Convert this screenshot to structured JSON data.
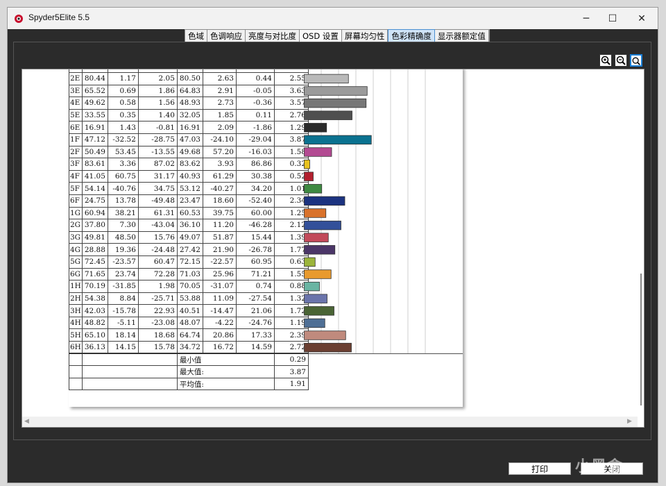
{
  "window": {
    "title": "Spyder5Elite 5.5"
  },
  "window_controls": {
    "minimize": "─",
    "maximize": "☐",
    "close": "✕"
  },
  "tabs": [
    {
      "label": "色域"
    },
    {
      "label": "色调响应"
    },
    {
      "label": "亮度与对比度"
    },
    {
      "label": "OSD 设置"
    },
    {
      "label": "屏幕均匀性"
    },
    {
      "label": "色彩精确度"
    },
    {
      "label": "显示器额定值"
    }
  ],
  "active_tab": "色彩精确度",
  "table": {
    "rows": [
      {
        "id": "2E",
        "l1": "80.44",
        "a1": "1.17",
        "b1": "2.05",
        "l2": "80.50",
        "a2": "2.63",
        "b2": "0.44",
        "de": "2.55",
        "color": "#b9b9b9"
      },
      {
        "id": "3E",
        "l1": "65.52",
        "a1": "0.69",
        "b1": "1.86",
        "l2": "64.83",
        "a2": "2.91",
        "b2": "-0.05",
        "de": "3.63",
        "color": "#9b9b9b"
      },
      {
        "id": "4E",
        "l1": "49.62",
        "a1": "0.58",
        "b1": "1.56",
        "l2": "48.93",
        "a2": "2.73",
        "b2": "-0.36",
        "de": "3.57",
        "color": "#777777"
      },
      {
        "id": "5E",
        "l1": "33.55",
        "a1": "0.35",
        "b1": "1.40",
        "l2": "32.05",
        "a2": "1.85",
        "b2": "0.11",
        "de": "2.76",
        "color": "#4f4f4f"
      },
      {
        "id": "6E",
        "l1": "16.91",
        "a1": "1.43",
        "b1": "-0.81",
        "l2": "16.91",
        "a2": "2.09",
        "b2": "-1.86",
        "de": "1.29",
        "color": "#2a2a2a"
      },
      {
        "id": "1F",
        "l1": "47.12",
        "a1": "-32.52",
        "b1": "-28.75",
        "l2": "47.03",
        "a2": "-24.10",
        "b2": "-29.04",
        "de": "3.87",
        "color": "#0b7290"
      },
      {
        "id": "2F",
        "l1": "50.49",
        "a1": "53.45",
        "b1": "-13.55",
        "l2": "49.68",
        "a2": "57.20",
        "b2": "-16.03",
        "de": "1.58",
        "color": "#b34a92"
      },
      {
        "id": "3F",
        "l1": "83.61",
        "a1": "3.36",
        "b1": "87.02",
        "l2": "83.62",
        "a2": "3.93",
        "b2": "86.86",
        "de": "0.32",
        "color": "#e7c21f"
      },
      {
        "id": "4F",
        "l1": "41.05",
        "a1": "60.75",
        "b1": "31.17",
        "l2": "40.93",
        "a2": "61.29",
        "b2": "30.38",
        "de": "0.52",
        "color": "#b21f2e"
      },
      {
        "id": "5F",
        "l1": "54.14",
        "a1": "-40.76",
        "b1": "34.75",
        "l2": "53.12",
        "a2": "-40.27",
        "b2": "34.20",
        "de": "1.01",
        "color": "#3f8a42"
      },
      {
        "id": "6F",
        "l1": "24.75",
        "a1": "13.78",
        "b1": "-49.48",
        "l2": "23.47",
        "a2": "18.60",
        "b2": "-52.40",
        "de": "2.34",
        "color": "#1c3380"
      },
      {
        "id": "1G",
        "l1": "60.94",
        "a1": "38.21",
        "b1": "61.31",
        "l2": "60.53",
        "a2": "39.75",
        "b2": "60.00",
        "de": "1.25",
        "color": "#d9722b"
      },
      {
        "id": "2G",
        "l1": "37.80",
        "a1": "7.30",
        "b1": "-43.04",
        "l2": "36.10",
        "a2": "11.20",
        "b2": "-46.28",
        "de": "2.12",
        "color": "#33509a"
      },
      {
        "id": "3G",
        "l1": "49.81",
        "a1": "48.50",
        "b1": "15.76",
        "l2": "49.07",
        "a2": "51.87",
        "b2": "15.44",
        "de": "1.39",
        "color": "#c24a5a"
      },
      {
        "id": "4G",
        "l1": "28.88",
        "a1": "19.36",
        "b1": "-24.48",
        "l2": "27.42",
        "a2": "21.90",
        "b2": "-26.78",
        "de": "1.77",
        "color": "#4b3668"
      },
      {
        "id": "5G",
        "l1": "72.45",
        "a1": "-23.57",
        "b1": "60.47",
        "l2": "72.15",
        "a2": "-22.57",
        "b2": "60.95",
        "de": "0.63",
        "color": "#9bb43b"
      },
      {
        "id": "6G",
        "l1": "71.65",
        "a1": "23.74",
        "b1": "72.28",
        "l2": "71.03",
        "a2": "25.96",
        "b2": "71.21",
        "de": "1.55",
        "color": "#e89a2e"
      },
      {
        "id": "1H",
        "l1": "70.19",
        "a1": "-31.85",
        "b1": "1.98",
        "l2": "70.05",
        "a2": "-31.07",
        "b2": "0.74",
        "de": "0.88",
        "color": "#6ab5a3"
      },
      {
        "id": "2H",
        "l1": "54.38",
        "a1": "8.84",
        "b1": "-25.71",
        "l2": "53.88",
        "a2": "11.09",
        "b2": "-27.54",
        "de": "1.32",
        "color": "#6a74ab"
      },
      {
        "id": "3H",
        "l1": "42.03",
        "a1": "-15.78",
        "b1": "22.93",
        "l2": "40.51",
        "a2": "-14.47",
        "b2": "21.06",
        "de": "1.72",
        "color": "#4a6435"
      },
      {
        "id": "4H",
        "l1": "48.82",
        "a1": "-5.11",
        "b1": "-23.08",
        "l2": "48.07",
        "a2": "-4.22",
        "b2": "-24.76",
        "de": "1.19",
        "color": "#4f6f95"
      },
      {
        "id": "5H",
        "l1": "65.10",
        "a1": "18.14",
        "b1": "18.68",
        "l2": "64.74",
        "a2": "20.86",
        "b2": "17.33",
        "de": "2.39",
        "color": "#c08a7d"
      },
      {
        "id": "6H",
        "l1": "36.13",
        "a1": "14.15",
        "b1": "15.78",
        "l2": "34.72",
        "a2": "16.72",
        "b2": "14.59",
        "de": "2.72",
        "color": "#6b3f32"
      }
    ],
    "summary": [
      {
        "label": "最小值",
        "value": "0.29"
      },
      {
        "label": "最大值:",
        "value": "3.87"
      },
      {
        "label": "平均值:",
        "value": "1.91"
      }
    ]
  },
  "chart_data": {
    "type": "bar",
    "orientation": "horizontal",
    "categories": [
      "2E",
      "3E",
      "4E",
      "5E",
      "6E",
      "1F",
      "2F",
      "3F",
      "4F",
      "5F",
      "6F",
      "1G",
      "2G",
      "3G",
      "4G",
      "5G",
      "6G",
      "1H",
      "2H",
      "3H",
      "4H",
      "5H",
      "6H"
    ],
    "values": [
      2.55,
      3.63,
      3.57,
      2.76,
      1.29,
      3.87,
      1.58,
      0.32,
      0.52,
      1.01,
      2.34,
      1.25,
      2.12,
      1.39,
      1.77,
      0.63,
      1.55,
      0.88,
      1.32,
      1.72,
      1.19,
      2.39,
      2.72
    ],
    "xlim": [
      0,
      8
    ],
    "grid": true
  },
  "buttons": {
    "print": "打印",
    "close": "关闭"
  },
  "watermark": "小黑盒"
}
